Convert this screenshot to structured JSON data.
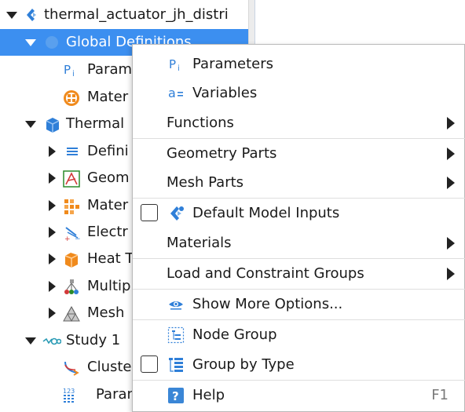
{
  "tree": {
    "root_label": "thermal_actuator_jh_distri",
    "items": [
      {
        "label": "Global Definitions"
      },
      {
        "label": "Param"
      },
      {
        "label": "Mater"
      },
      {
        "label": "Thermal"
      },
      {
        "label": "Defini"
      },
      {
        "label": "Geom"
      },
      {
        "label": "Mater"
      },
      {
        "label": "Electr"
      },
      {
        "label": "Heat T"
      },
      {
        "label": "Multip"
      },
      {
        "label": "Mesh"
      },
      {
        "label": "Study 1"
      },
      {
        "label": "Cluste"
      },
      {
        "label": "Paran"
      }
    ]
  },
  "menu": {
    "parameters": "Parameters",
    "variables": "Variables",
    "functions": "Functions",
    "geometry_parts": "Geometry Parts",
    "mesh_parts": "Mesh Parts",
    "default_model_inputs": "Default Model Inputs",
    "materials": "Materials",
    "load_constraint_groups": "Load and Constraint Groups",
    "show_more_options": "Show More Options...",
    "node_group": "Node Group",
    "group_by_type": "Group by Type",
    "help": "Help",
    "help_shortcut": "F1"
  },
  "colors": {
    "selection": "#3c8ff0",
    "icon_blue": "#2f7fd8",
    "icon_orange": "#f08a1c"
  }
}
